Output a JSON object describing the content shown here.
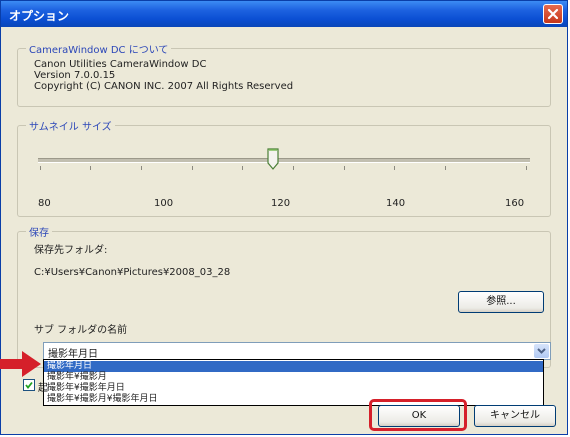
{
  "window": {
    "title": "オプション",
    "accent_color": "#0b4fd3",
    "close_icon": "close-icon"
  },
  "about": {
    "group_title": "CameraWindow DC について",
    "product": "Canon Utilities CameraWindow DC",
    "version": "Version 7.0.0.15",
    "copyright": "Copyright (C) CANON INC. 2007 All Rights Reserved"
  },
  "thumbnail": {
    "group_title": "サムネイル サイズ",
    "slider": {
      "min": 80,
      "max": 160,
      "value": 120
    },
    "tick_labels": [
      "80",
      "100",
      "120",
      "140",
      "160"
    ]
  },
  "save": {
    "group_title": "保存",
    "dest_label": "保存先フォルダ:",
    "dest_path": "C:¥Users¥Canon¥Pictures¥2008_03_28",
    "browse_label": "参照...",
    "subfolder_label": "サブ フォルダの名前",
    "subfolder_value": "撮影年月日",
    "options": [
      "撮影年月日",
      "撮影年¥撮影月",
      "撮影年¥撮影年月日",
      "撮影年¥撮影月¥撮影年月日"
    ],
    "checkbox_label": "起"
  },
  "footer": {
    "ok_label": "OK",
    "cancel_label": "キャンセル"
  },
  "annotation": {
    "highlight_color": "#d5202a"
  }
}
